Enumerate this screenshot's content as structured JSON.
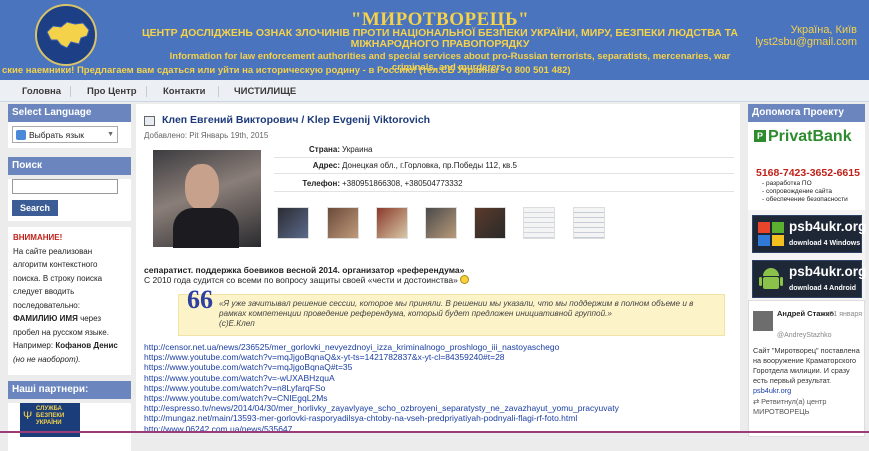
{
  "header": {
    "title": "\"МИРОТВОРЕЦЬ\"",
    "subtitle": "ЦЕНТР ДОСЛІДЖЕНЬ ОЗНАК ЗЛОЧИНІВ ПРОТИ НАЦІОНАЛЬНОЇ БЕЗПЕКИ УКРАЇНИ, МИРУ, БЕЗПЕКИ ЛЮДСТВА ТА МІЖНАРОДНОГО ПРАВОПОРЯДКУ",
    "subtitle_en": "Information for law enforcement authorities and special services about pro-Russian terrorists, separatists, mercenaries, war criminals, and murderers.",
    "location": "Україна, Київ",
    "email": "lyst2sbu@gmail.com",
    "ticker": "ские наемники! Предлагаем вам сдаться или уйти на историческую родину - в Россию! (тел.СБ Украины - 0 800 501 482)"
  },
  "nav": [
    "Головна",
    "Про Центр",
    "Контакти",
    "ЧИСТИЛИЩЕ"
  ],
  "left": {
    "lang_heading": "Select Language",
    "lang_select": "Выбрать язык",
    "search_heading": "Поиск",
    "search_button": "Search",
    "notice_title": "ВНИМАНИЕ!",
    "notice_text": "На сайте реализован алгоритм контекстного поиска. В строку поиска следует вводить последовательно:",
    "notice_key": "ФАМИЛИЮ ИМЯ",
    "notice_text2": "через пробел на русском языке. Например:",
    "notice_example": "Кофанов Денис",
    "notice_note": "(но не наоборот).",
    "partners_heading": "Наші партнери:",
    "partner_logo_text": "СЛУЖБА БЕЗПЕКИ УКРАЇНИ"
  },
  "article": {
    "title": "Клеп Евгений Викторович / Klep Evgenij Viktorovich",
    "date": "Добавлено: Pit Январь 19th, 2015",
    "fields": [
      {
        "label": "Страна:",
        "value": "Украина"
      },
      {
        "label": "Адрес:",
        "value": "Донецкая обл., г.Горловка, пр.Победы 112, кв.5"
      },
      {
        "label": "Телефон:",
        "value": "+380951866308, +380504773332"
      }
    ],
    "summary_bold": "сепаратист. поддержка боевиков весной 2014. организатор «референдума»",
    "summary": "С 2010 года судится со всеми по вопросу защиты своей «чести и достоинства»",
    "quote_mark": "66",
    "quote": "«Я уже зачитывал решение сессии, которое мы приняли. В решении мы указали, что мы поддержим в полном объеме и в рамках компетенции проведение референдума, который будет предложен инициативной группой.»",
    "quote_author": "(с)Е.Клеп",
    "links": [
      "http://censor.net.ua/news/236525/mer_gorlovki_nevyezdnoyi_izza_kriminalnogo_proshlogo_iii_nastoyaschego",
      "https://www.youtube.com/watch?v=mqJjgoBqnaQ&x-yt-ts=1421782837&x-yt-cl=84359240#t=28",
      "https://www.youtube.com/watch?v=mqJjgoBqnaQ#t=35",
      "https://www.youtube.com/watch?v=-wUXABHzquA",
      "https://www.youtube.com/watch?v=n8LyfarqFSo",
      "https://www.youtube.com/watch?v=CNIEgqL2Ms",
      "http://espresso.tv/news/2014/04/30/mer_horlivky_zayavlyaye_scho_ozbroyeni_separatysty_ne_zavazhayut_yomu_pracyuvaty",
      "http://mungaz.net/main/13593-mer-gorlovki-rasporyadilsya-chtoby-na-vseh-predpriyatiyah-podnyali-flagi-rf-foto.html",
      "http://www.06242.com.ua/news/535647"
    ]
  },
  "right": {
    "help_heading": "Допомога Проекту",
    "privat_logo": "PrivatBank",
    "privat_card": "5168-7423-3652-6615",
    "privat_items": [
      "- разработка ПО",
      "- сопровождение сайта",
      "- обеспечение безопасности"
    ],
    "dl_windows_title": "psb4ukr.org",
    "dl_windows_sub": "download 4 Windows",
    "dl_android_title": "psb4ukr.org",
    "dl_android_sub": "download 4 Android",
    "tweet_name": "Андрей Стажко",
    "tweet_date": "31 января",
    "tweet_handle": "@AndreyStazhko",
    "tweet_text": "Сайт \"Миротворец\" поставлена на вооружение Краматорского Горотдела милиции. И сразу есть первый результат.",
    "tweet_link": "psb4ukr.org",
    "tweet_retweet": "Ретвитнул(а) центр МИРОТВОРЕЦЬ"
  },
  "colors": {
    "header_bg": "#4b74be",
    "header_text": "#f4d24a",
    "link": "#1a3ea3",
    "box_heading": "#6b86be",
    "accent_red": "#c0221b"
  }
}
